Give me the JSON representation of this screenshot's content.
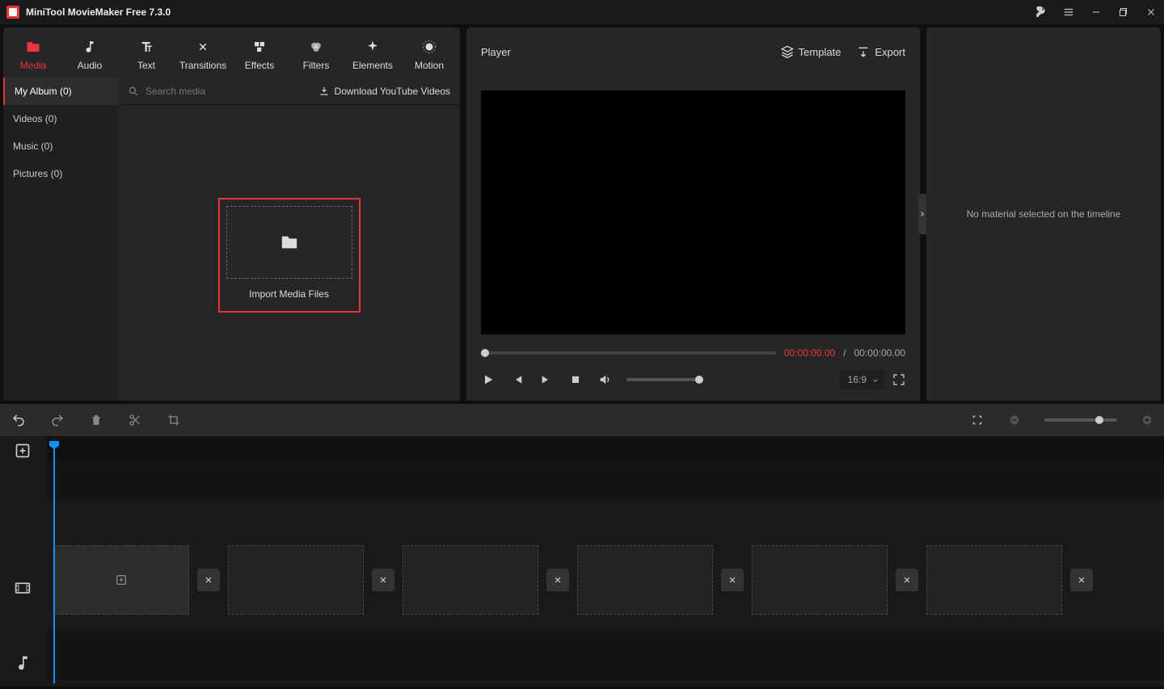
{
  "titlebar": {
    "title": "MiniTool MovieMaker Free 7.3.0"
  },
  "nav": {
    "media": "Media",
    "audio": "Audio",
    "text": "Text",
    "transitions": "Transitions",
    "effects": "Effects",
    "filters": "Filters",
    "elements": "Elements",
    "motion": "Motion"
  },
  "sidebar": {
    "album": "My Album (0)",
    "videos": "Videos (0)",
    "music": "Music (0)",
    "pictures": "Pictures (0)"
  },
  "search": {
    "placeholder": "Search media"
  },
  "download_yt": "Download YouTube Videos",
  "import_label": "Import Media Files",
  "player": {
    "title": "Player",
    "template": "Template",
    "export": "Export",
    "cur": "00:00:00.00",
    "sep": "/",
    "dur": "00:00:00.00",
    "aspect": "16:9"
  },
  "right": {
    "no_selection": "No material selected on the timeline"
  }
}
